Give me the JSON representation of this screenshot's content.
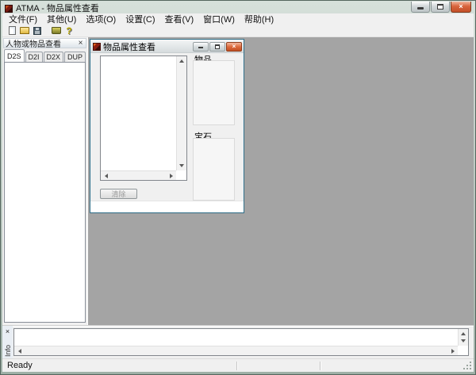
{
  "window": {
    "title": "ATMA - 物品属性查看",
    "app_icon": "atma-logo-icon",
    "close_glyph": "×"
  },
  "menu_bar": {
    "items": [
      {
        "label": "文件(F)"
      },
      {
        "label": "其他(U)"
      },
      {
        "label": "选项(O)"
      },
      {
        "label": "设置(C)"
      },
      {
        "label": "查看(V)"
      },
      {
        "label": "窗口(W)"
      },
      {
        "label": "帮助(H)"
      }
    ]
  },
  "toolbar": {
    "buttons": [
      {
        "icon": "new-file-icon"
      },
      {
        "icon": "open-folder-icon"
      },
      {
        "icon": "save-icon"
      },
      {
        "icon": "print-icon"
      },
      {
        "icon": "help-icon",
        "glyph": "?"
      }
    ]
  },
  "left_pane": {
    "title": "人物或物品查看",
    "close_glyph": "×",
    "tabs": [
      {
        "label": "D2S",
        "active": true
      },
      {
        "label": "D2I",
        "active": false
      },
      {
        "label": "D2X",
        "active": false
      },
      {
        "label": "DUP",
        "active": false
      }
    ]
  },
  "child_window": {
    "title": "物品属性查看",
    "window_icon": "atma-demon-icon",
    "item_label": "物品",
    "gem_label": "宝石",
    "clear_button": "清除"
  },
  "info_panel": {
    "tab_label": "Info",
    "close_glyph": "×"
  },
  "status_bar": {
    "text": "Ready"
  },
  "colors": {
    "mdi_background": "#a4a4a4",
    "chrome_background": "#f0f0f0",
    "frame_tint": "#c3d0ca",
    "close_button_red": "#d8643c",
    "child_window_border": "#34718a",
    "info_tab_background": "#e9eef4"
  }
}
